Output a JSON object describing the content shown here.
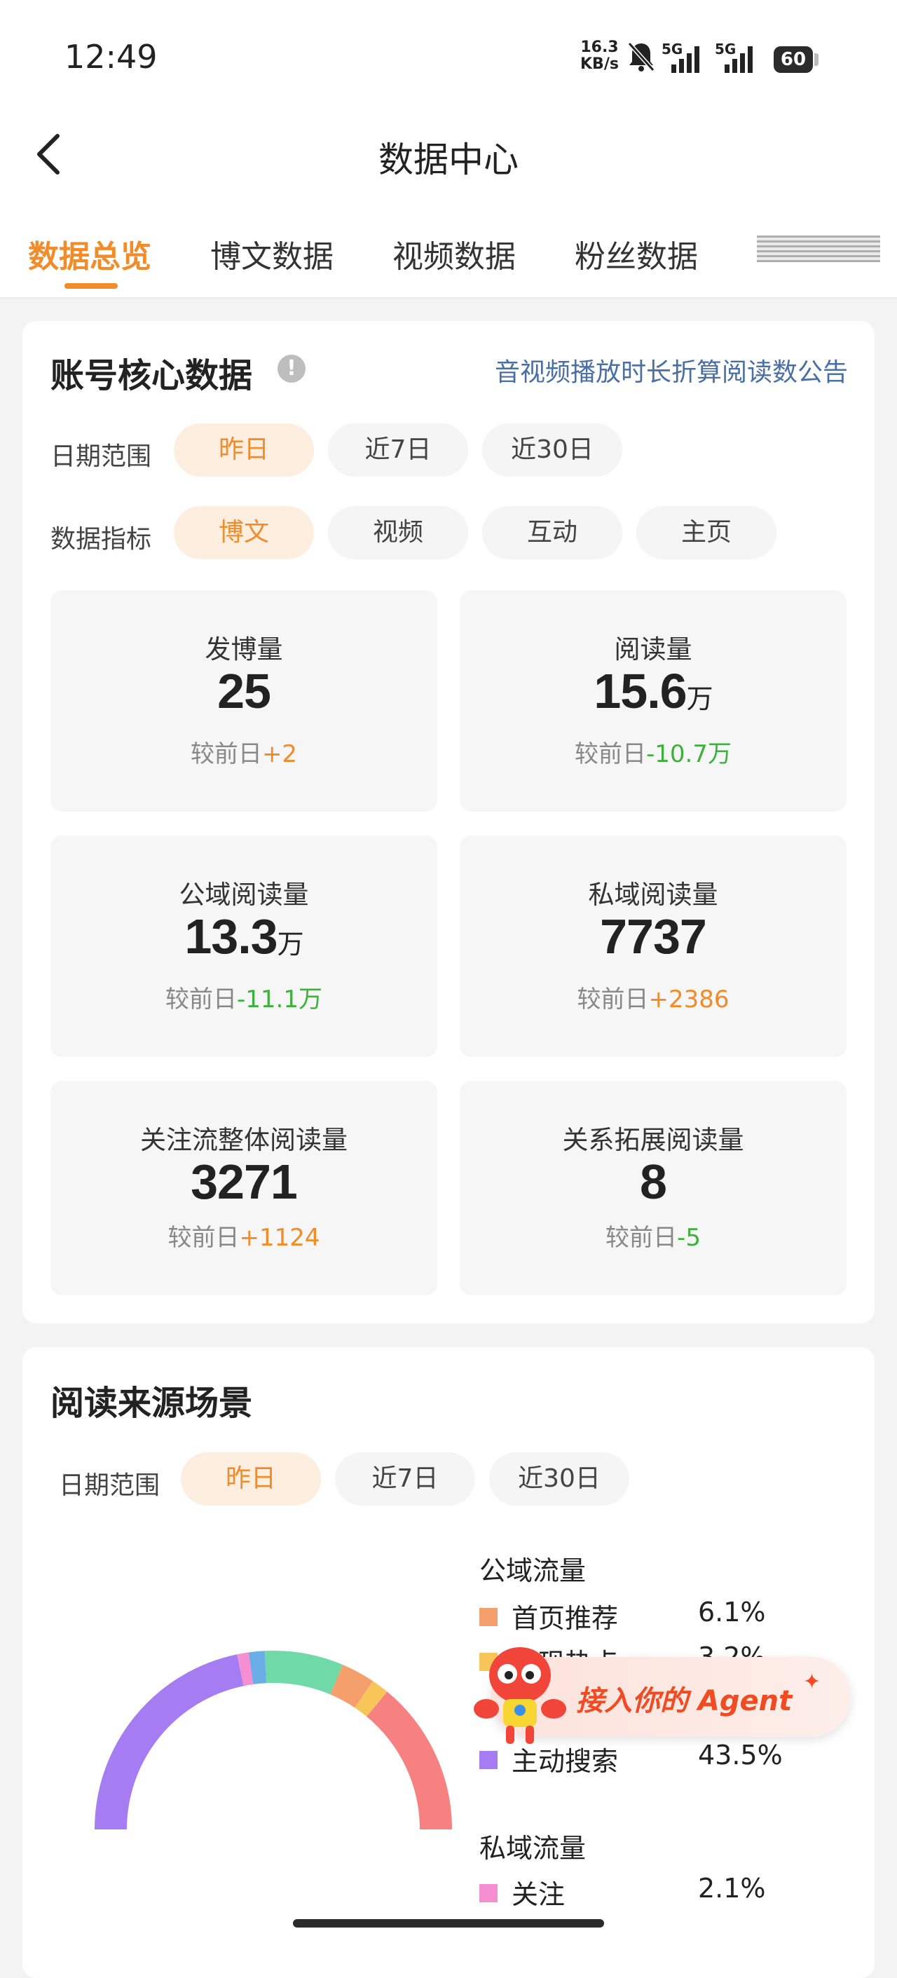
{
  "status_bar": {
    "time": "12:49",
    "net_speed_value": "16.3",
    "net_speed_unit": "KB/s",
    "signal_1": "5G",
    "signal_2": "5G",
    "battery": "60"
  },
  "nav": {
    "title": "数据中心"
  },
  "tabs": [
    {
      "label": "数据总览",
      "active": true
    },
    {
      "label": "博文数据",
      "active": false
    },
    {
      "label": "视频数据",
      "active": false
    },
    {
      "label": "粉丝数据",
      "active": false
    }
  ],
  "core": {
    "title": "账号核心数据",
    "info_icon": "!",
    "notice_link": "音视频播放时长折算阅读数公告",
    "date_label": "日期范围",
    "date_options": [
      "昨日",
      "近7日",
      "近30日"
    ],
    "metric_label": "数据指标",
    "metric_options": [
      "博文",
      "视频",
      "互动",
      "主页"
    ],
    "compare_prefix": "较前日",
    "stats": [
      {
        "label": "发博量",
        "value": "25",
        "unit": "",
        "delta": "+2",
        "trend": "up"
      },
      {
        "label": "阅读量",
        "value": "15.6",
        "unit": "万",
        "delta": "-10.7万",
        "trend": "down"
      },
      {
        "label": "公域阅读量",
        "value": "13.3",
        "unit": "万",
        "delta": "-11.1万",
        "trend": "down"
      },
      {
        "label": "私域阅读量",
        "value": "7737",
        "unit": "",
        "delta": "+2386",
        "trend": "up"
      },
      {
        "label": "关注流整体阅读量",
        "value": "3271",
        "unit": "",
        "delta": "+1124",
        "trend": "up"
      },
      {
        "label": "关系拓展阅读量",
        "value": "8",
        "unit": "",
        "delta": "-5",
        "trend": "down"
      }
    ]
  },
  "source": {
    "title": "阅读来源场景",
    "date_label": "日期范围",
    "date_options": [
      "昨日",
      "近7日",
      "近30日"
    ],
    "public_group": "公域流量",
    "private_group": "私域流量",
    "legend": [
      {
        "name": "首页推荐",
        "pct": "6.1%",
        "color": "#f5a06c"
      },
      {
        "name": "发现热点",
        "pct": "3.2%",
        "color": "#f7c55a"
      },
      {
        "name": "主动搜索",
        "pct": "43.5%",
        "color": "#a57cf2"
      },
      {
        "name": "关注",
        "pct": "2.1%",
        "color": "#f68fd2"
      }
    ]
  },
  "chart_data": {
    "type": "pie",
    "style": "half-donut",
    "segments": [
      {
        "label": "首页推荐",
        "value": 6.1,
        "color": "#f5a06c"
      },
      {
        "label": "发现热点",
        "value": 3.2,
        "color": "#f7c55a"
      },
      {
        "label": "",
        "value": 28,
        "color": "#f78080"
      },
      {
        "label": "主动搜索",
        "value": 43.5,
        "color": "#a57cf2"
      },
      {
        "label": "关注",
        "value": 2.1,
        "color": "#f68fd2"
      },
      {
        "label": "",
        "value": 2.9,
        "color": "#6aaee8"
      },
      {
        "label": "",
        "value": 14.2,
        "color": "#6fd9a8"
      }
    ]
  },
  "agent_banner": {
    "text": "接入你的 Agent",
    "spark": "✦"
  }
}
